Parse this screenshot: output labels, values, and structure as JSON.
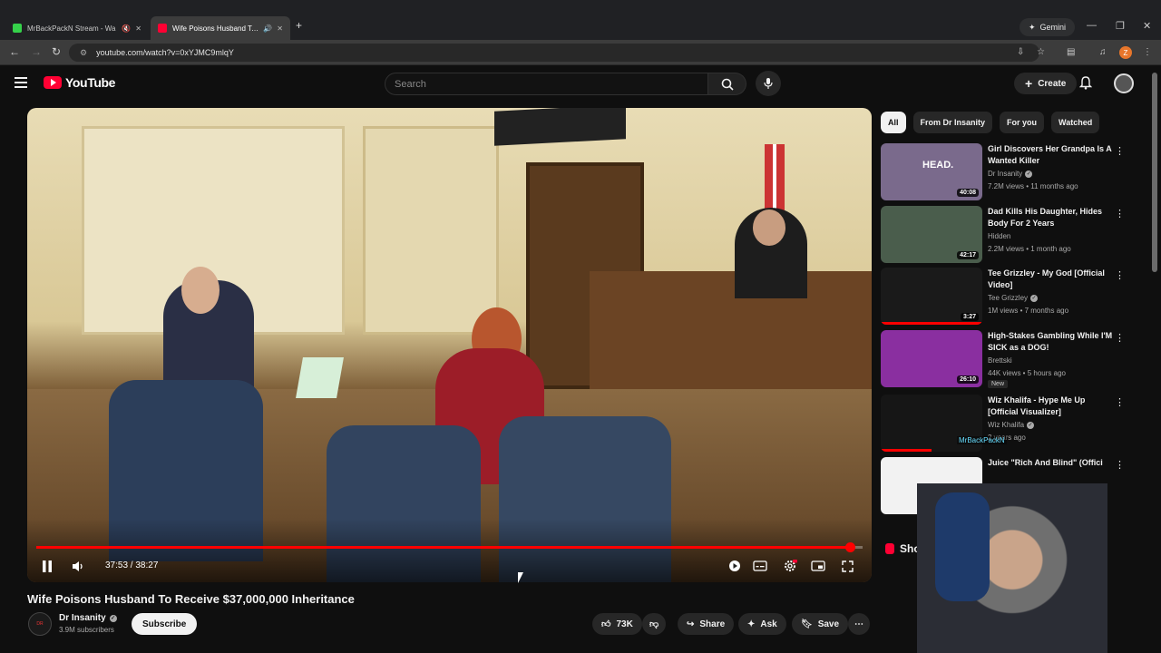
{
  "browser": {
    "tabs": [
      {
        "title": "MrBackPackN Stream - Wa",
        "favicon_color": "#35d14a",
        "active": false
      },
      {
        "title": "Wife Poisons Husband To R",
        "favicon_color": "#ff0033",
        "active": true
      }
    ],
    "gemini_label": "Gemini",
    "url": "youtube.com/watch?v=0xYJMC9mlqY",
    "profile_initial": "Z"
  },
  "masthead": {
    "logo_text": "YouTube",
    "search_placeholder": "Search",
    "create_label": "Create"
  },
  "player": {
    "current_time": "37:53",
    "duration": "38:27",
    "time_display": "37:53 / 38:27",
    "progress_fraction": 0.985,
    "state": "playing"
  },
  "video": {
    "title": "Wife Poisons Husband To Receive $37,000,000 Inheritance",
    "channel": "Dr Insanity",
    "subscribers": "3.9M subscribers",
    "subscribe_label": "Subscribe",
    "likes": "73K",
    "share_label": "Share",
    "ask_label": "Ask",
    "save_label": "Save",
    "avatar_text": "DR"
  },
  "chips": [
    {
      "label": "All",
      "selected": true
    },
    {
      "label": "From Dr Insanity",
      "selected": false
    },
    {
      "label": "For you",
      "selected": false
    },
    {
      "label": "Watched",
      "selected": false
    }
  ],
  "recommendations": [
    {
      "title": "Girl Discovers Her Grandpa Is A Wanted Killer",
      "channel": "Dr Insanity",
      "verified": true,
      "meta": "7.2M views • 11 months ago",
      "duration": "40:08",
      "thumb_color": "#7a6a8c",
      "thumb_text": "HEAD.",
      "watched_fraction": 0,
      "is_new": false
    },
    {
      "title": "Dad Kills His Daughter, Hides Body For 2 Years",
      "channel": "Hidden",
      "verified": false,
      "meta": "2.2M views • 1 month ago",
      "duration": "42:17",
      "thumb_color": "#4a5d4c",
      "watched_fraction": 0,
      "is_new": false
    },
    {
      "title": "Tee Grizzley - My God [Official Video]",
      "channel": "Tee Grizzley",
      "verified": true,
      "meta": "1M views • 7 months ago",
      "duration": "3:27",
      "thumb_color": "#1a1a1a",
      "watched_fraction": 1,
      "is_new": false
    },
    {
      "title": "High-Stakes Gambling While I'M SICK as a DOG!",
      "channel": "Brettski",
      "verified": false,
      "meta": "44K views • 5 hours ago",
      "duration": "26:10",
      "thumb_color": "#8a2fa0",
      "watched_fraction": 0,
      "is_new": true,
      "new_label": "New"
    },
    {
      "title": "Wiz Khalifa - Hype Me Up [Official Visualizer]",
      "channel": "Wiz Khalifa",
      "verified": true,
      "meta": "2 years ago",
      "duration": "",
      "thumb_color": "#161616",
      "watched_fraction": 0.5,
      "is_new": false
    },
    {
      "title": "Juice \"Rich And Blind\" (Offici",
      "channel": "",
      "verified": false,
      "meta": "",
      "duration": "",
      "thumb_color": "#f2f2f2",
      "watched_fraction": 0,
      "is_new": false
    }
  ],
  "shorts_label": "Shorts",
  "overlay_tag": "MrBackPackN"
}
